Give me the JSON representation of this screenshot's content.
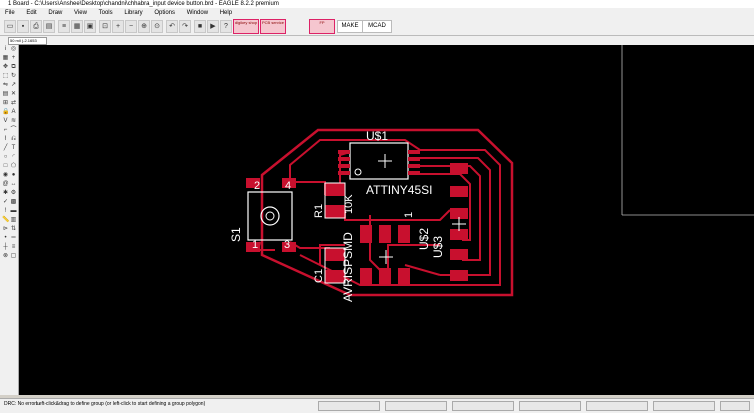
{
  "window": {
    "title": "1 Board - C:\\Users\\Anshee\\Desktop\\chandni\\chhabra_input device button.brd - EAGLE 8.2.2 premium"
  },
  "menu": [
    "File",
    "Edit",
    "Draw",
    "View",
    "Tools",
    "Library",
    "Options",
    "Window",
    "Help"
  ],
  "toolbar": {
    "make_label": "MAKE",
    "mcad_label": "MCAD",
    "pink1": "digikey shop",
    "pink2": "PCB service",
    "pink3": "FP"
  },
  "coord": "50 mil (-2.1653 0.52)",
  "canvas": {
    "labels": {
      "u1_name": "U$1",
      "u1_value": "ATTINY45SI",
      "s1_name": "S1",
      "r1_name": "R1",
      "r1_value": "10K",
      "c1_name": "C1",
      "avr_value": "AVRISPSMD",
      "avr_one": "1",
      "u2_name": "U$2",
      "u3_name": "U$3",
      "pin1": "1",
      "pin2": "2",
      "pin3": "3",
      "pin4": "4"
    }
  },
  "status": {
    "drc": "DRC: No errors.",
    "hint": "Left-click&drag to define group (or left-click to start defining a group polygon)"
  },
  "colors": {
    "background": "#000000",
    "copper": "#c8102e",
    "text": "#ffffff",
    "ui": "#f0f0f0"
  }
}
